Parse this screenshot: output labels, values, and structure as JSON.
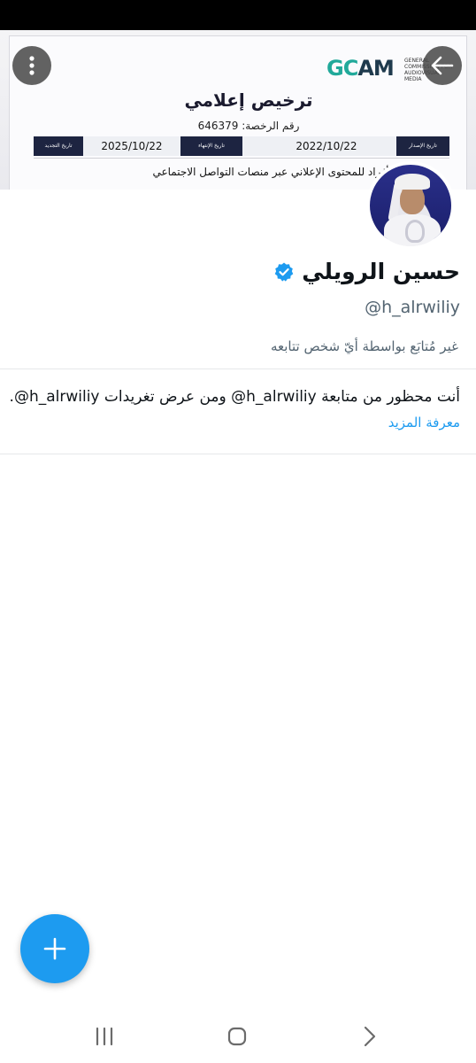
{
  "banner": {
    "logo_text": "GCAM",
    "logo_subtext": "GENERAL COMMISSION FOR AUDIOVISUAL MEDIA",
    "title": "ترخيص إعلامي",
    "license_number": "رقم الرخصة: 646379",
    "issue_label": "تاريخ الإصدار",
    "issue_date": "2022/10/22",
    "expiry_label": "تاريخ الإنتهاء",
    "expiry_date": "2025/10/22",
    "renewal_label": "تاريخ التجديد",
    "description": "تقديم الأفراد للمحتوى الإعلاني عبر منصات التواصل الاجتماعي"
  },
  "header": {
    "more_icon": "more-vertical-icon",
    "back_icon": "arrow-back-icon"
  },
  "profile": {
    "display_name": "حسين الرويلي",
    "verified_icon": "verified-badge-icon",
    "handle": "@h_alrwiliy",
    "follow_note": "غير مُتابَع بواسطة أيّ شخص تتابعه"
  },
  "blocked": {
    "message": "أنت محظور من متابعة h_alrwiliy@ ومن عرض تغريدات h_alrwiliy@.",
    "learn_more": "معرفة المزيد"
  },
  "fab": {
    "icon": "plus-icon"
  },
  "system_nav": {
    "recents_icon": "recents-icon",
    "home_icon": "home-icon",
    "back_icon": "chevron-right-icon"
  },
  "colors": {
    "accent": "#1d9bf0",
    "text_primary": "#0f1419",
    "text_secondary": "#536471"
  }
}
